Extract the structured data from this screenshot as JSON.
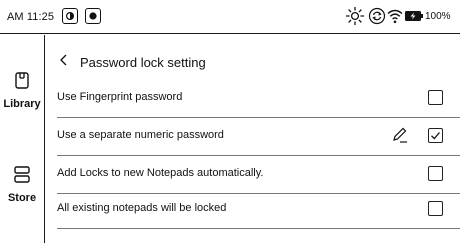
{
  "status_bar": {
    "time": "AM 11:25",
    "battery_percent": "100%",
    "icons": [
      "app-icon-half-circle",
      "app-icon-record",
      "brightness-icon",
      "sync-icon",
      "wifi-icon",
      "battery-charging-icon"
    ]
  },
  "sidebar": {
    "items": [
      {
        "label": "Library",
        "icon": "library-icon"
      },
      {
        "label": "Store",
        "icon": "store-icon"
      }
    ]
  },
  "main": {
    "title": "Password lock setting",
    "settings": [
      {
        "label": "Use Fingerprint password",
        "checked": false,
        "editable": false
      },
      {
        "label": "Use a separate numeric password",
        "checked": true,
        "editable": true
      },
      {
        "label": "Add Locks to new Notepads automatically.",
        "checked": false,
        "editable": false
      },
      {
        "label": "All existing notepads will be locked",
        "checked": false,
        "editable": false
      }
    ]
  }
}
